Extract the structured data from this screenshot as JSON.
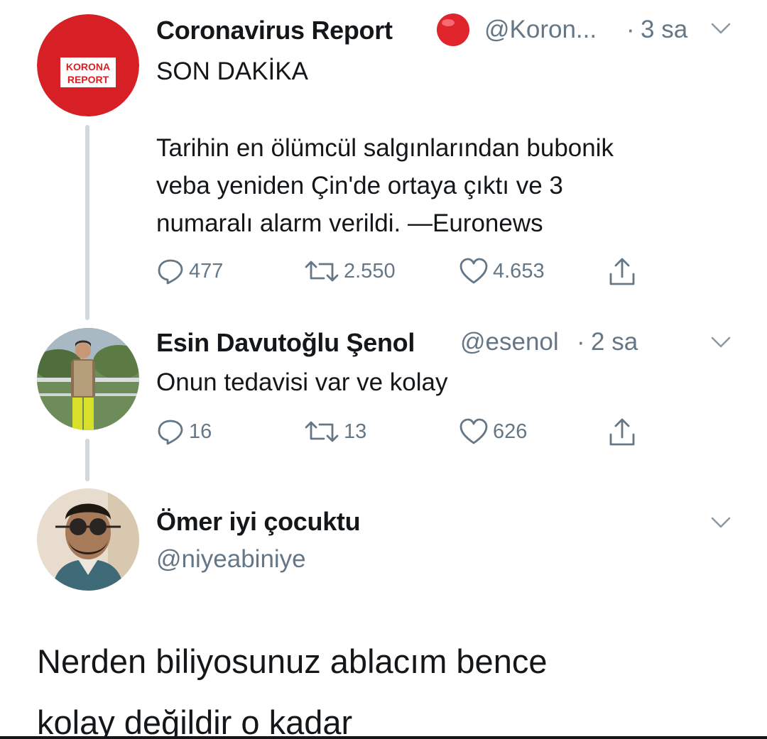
{
  "tweet1": {
    "avatar_text": [
      "KORONA",
      "REPORT"
    ],
    "name": "Coronavirus Report",
    "handle": "@Koron...",
    "time": "3 sa",
    "lines": [
      "SON DAKİKA",
      "",
      "Tarihin en ölümcül salgınlarından bubonik",
      "veba yeniden Çin'de ortaya çıktı ve 3",
      "numaralı alarm verildi. —Euronews"
    ],
    "replies": "477",
    "retweets": "2.550",
    "likes": "4.653"
  },
  "tweet2": {
    "name": "Esin Davutoğlu Şenol",
    "handle": "@esenol",
    "time": "2 sa",
    "text": "Onun tedavisi var ve kolay",
    "replies": "16",
    "retweets": "13",
    "likes": "626"
  },
  "tweet3": {
    "name": "Ömer iyi çocuktu",
    "handle": "@niyeabiniye"
  },
  "caption": {
    "lines": [
      "Nerden biliyosunuz ablacım bence",
      "kolay değildir o kadar"
    ]
  },
  "separator": "·",
  "colors": {
    "brand_red": "#d71f26",
    "secondary_text": "#657786",
    "primary_text": "#14171a",
    "thread_line": "#cfd9de"
  },
  "icons": {
    "reply": "speech-bubble-icon",
    "retweet": "retweet-arrows-icon",
    "like": "heart-outline-icon",
    "share": "share-upload-icon",
    "menu": "chevron-down-icon",
    "badge": "red-circle-emoji-icon"
  }
}
